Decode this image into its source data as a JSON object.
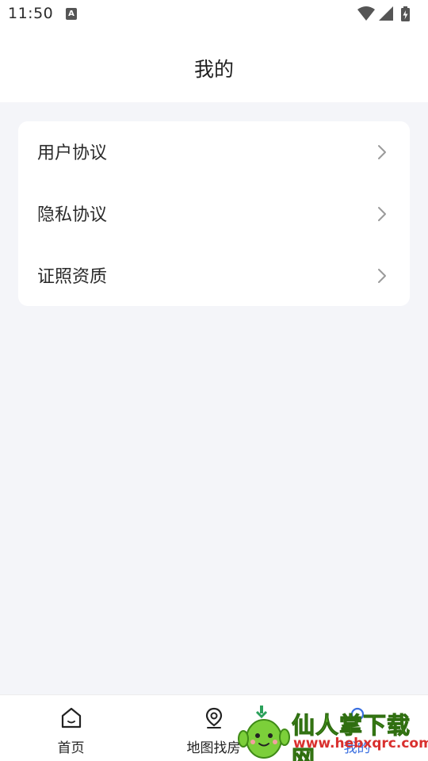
{
  "status_bar": {
    "time": "11:50",
    "notification_icon": "a-icon",
    "wifi_icon": "wifi-icon",
    "signal_icon": "signal-icon",
    "battery_icon": "battery-charging-icon"
  },
  "header": {
    "title": "我的"
  },
  "menu": {
    "items": [
      {
        "label": "用户协议",
        "icon": "chevron-right-icon"
      },
      {
        "label": "隐私协议",
        "icon": "chevron-right-icon"
      },
      {
        "label": "证照资质",
        "icon": "chevron-right-icon"
      }
    ]
  },
  "tabbar": {
    "active_color": "#3a6fe0",
    "tabs": [
      {
        "label": "首页",
        "icon": "home-icon"
      },
      {
        "label": "地图找房",
        "icon": "map-pin-icon"
      },
      {
        "label": "",
        "icon": ""
      },
      {
        "label": "我的",
        "icon": "user-icon"
      }
    ]
  },
  "watermark": {
    "text": "仙人掌下载网",
    "url": "www.hebxqrc.com"
  }
}
